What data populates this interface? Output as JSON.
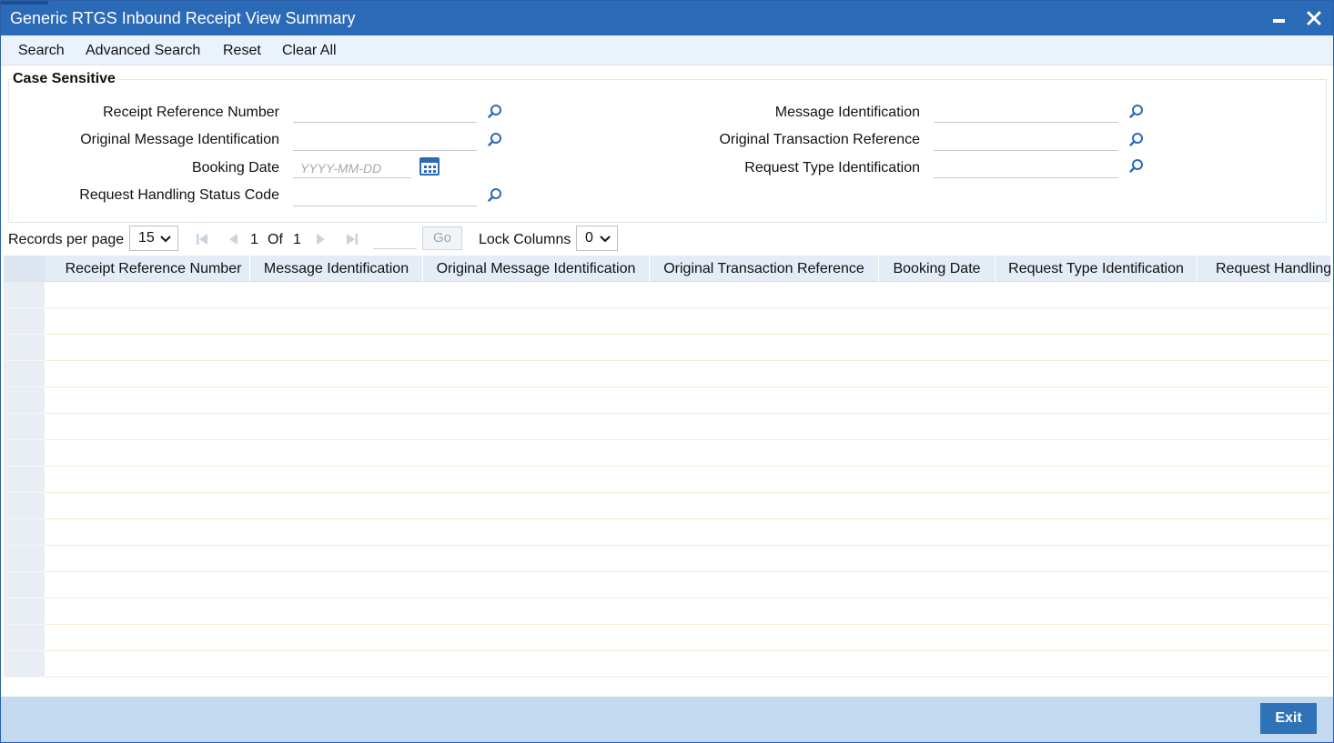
{
  "window": {
    "title": "Generic RTGS Inbound Receipt View Summary",
    "accent_color": "#2a6ab7",
    "icons": {
      "minimize": "minimize-icon",
      "close": "close-icon"
    }
  },
  "toolbar": {
    "search_label": "Search",
    "advanced_search_label": "Advanced Search",
    "reset_label": "Reset",
    "clear_all_label": "Clear All"
  },
  "criteria": {
    "legend": "Case Sensitive",
    "fields": {
      "receipt_reference_number": {
        "label": "Receipt Reference Number",
        "value": ""
      },
      "original_message_identification": {
        "label": "Original Message Identification",
        "value": ""
      },
      "booking_date": {
        "label": "Booking Date",
        "value": "",
        "placeholder": "YYYY-MM-DD"
      },
      "request_handling_status_code": {
        "label": "Request Handling Status Code",
        "value": ""
      },
      "message_identification": {
        "label": "Message Identification",
        "value": ""
      },
      "original_transaction_reference": {
        "label": "Original Transaction Reference",
        "value": ""
      },
      "request_type_identification": {
        "label": "Request Type Identification",
        "value": ""
      }
    }
  },
  "pager": {
    "records_per_page_label": "Records per page",
    "records_per_page_value": "15",
    "current_page": "1",
    "of_label": "Of",
    "total_pages": "1",
    "page_input_value": "",
    "go_label": "Go",
    "lock_columns_label": "Lock Columns",
    "lock_columns_value": "0"
  },
  "grid": {
    "columns": [
      "Receipt Reference Number",
      "Message Identification",
      "Original Message Identification",
      "Original Transaction Reference",
      "Booking Date",
      "Request Type Identification",
      "Request Handling"
    ],
    "rows": [
      [],
      [],
      [],
      [],
      [],
      [],
      [],
      [],
      [],
      [],
      [],
      [],
      [],
      [],
      []
    ]
  },
  "footer": {
    "exit_label": "Exit"
  }
}
